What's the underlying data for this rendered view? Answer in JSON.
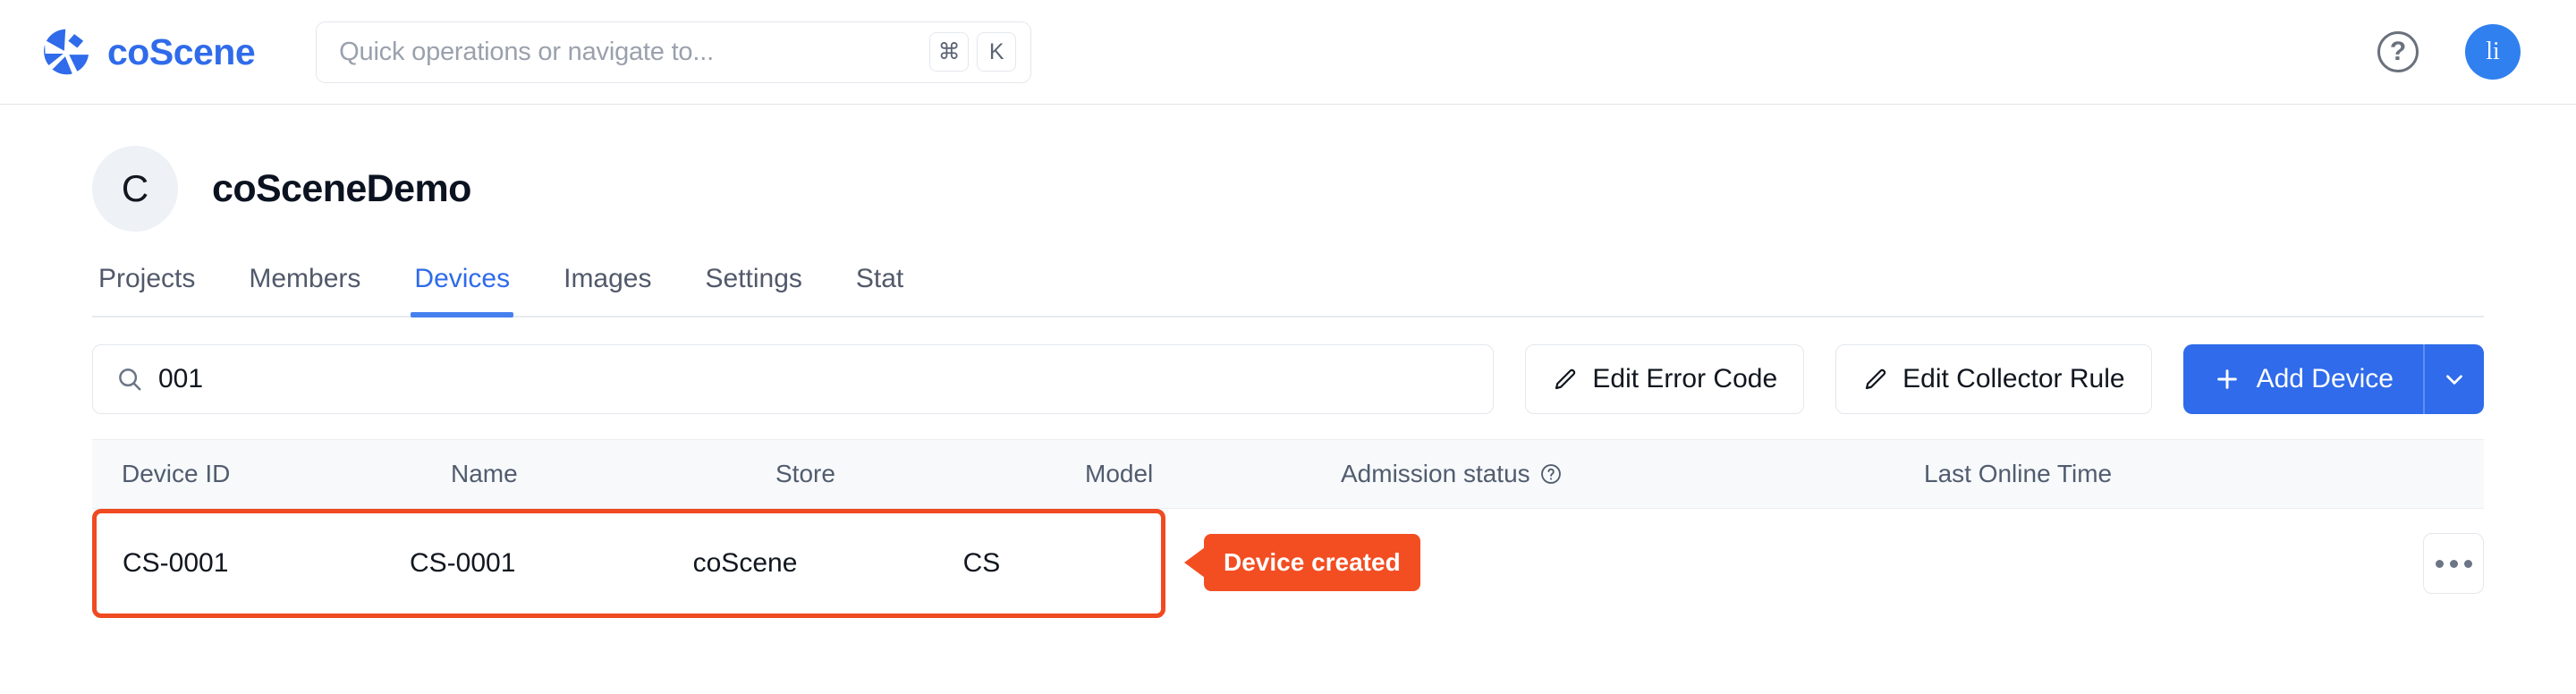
{
  "topbar": {
    "brand_name": "coScene",
    "search": {
      "placeholder": "Quick operations or navigate to...",
      "kbd_mod": "⌘",
      "kbd_key": "K"
    },
    "help_label": "?",
    "avatar_initials": "li"
  },
  "org": {
    "avatar_initial": "C",
    "name": "coSceneDemo"
  },
  "tabs": [
    {
      "label": "Projects",
      "active": false
    },
    {
      "label": "Members",
      "active": false
    },
    {
      "label": "Devices",
      "active": true
    },
    {
      "label": "Images",
      "active": false
    },
    {
      "label": "Settings",
      "active": false
    },
    {
      "label": "Stat",
      "active": false
    }
  ],
  "toolbar": {
    "search_value": "001",
    "search_placeholder": "",
    "edit_error_code_label": "Edit Error Code",
    "edit_collector_rule_label": "Edit Collector Rule",
    "add_device_label": "Add Device",
    "add_device_plus": "+"
  },
  "table": {
    "columns": [
      "Device ID",
      "Name",
      "Store",
      "Model",
      "Admission status",
      "Last Online Time"
    ],
    "admission_help": "?",
    "rows": [
      {
        "device_id": "CS-0001",
        "name": "CS-0001",
        "store": "coScene",
        "model": "CS",
        "admission_status": "",
        "last_online_time": ""
      }
    ]
  },
  "annotation": {
    "label": "Device created",
    "color": "#f24e22"
  },
  "colors": {
    "brand_blue": "#2f6bea",
    "accent_blue": "#4680ef",
    "annotation_orange": "#f24e22",
    "avatar_blue": "#3080f0",
    "table_header_bg": "#f7f9fb"
  }
}
